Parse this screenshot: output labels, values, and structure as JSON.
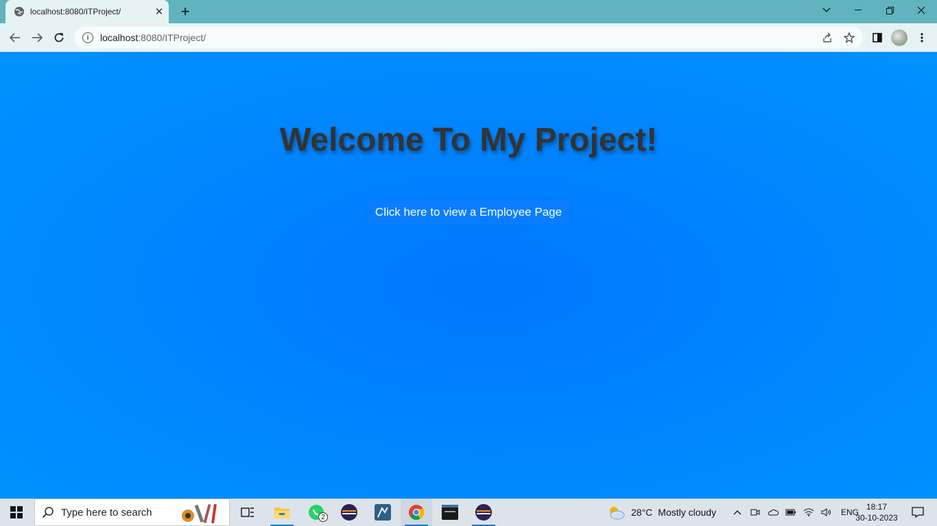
{
  "browser": {
    "tab_title": "localhost:8080/ITProject/",
    "tab_close": "✕",
    "new_tab": "+",
    "url_host": "localhost",
    "url_rest": ":8080/ITProject/",
    "icons": [
      "globe-icon",
      "back-icon",
      "forward-icon",
      "reload-icon",
      "share-icon",
      "star-icon",
      "side-panel-icon",
      "profile-avatar",
      "menu-icon"
    ]
  },
  "page": {
    "heading": "Welcome To My Project!",
    "button_label": "Click here to view a Employee Page",
    "background_color": "#0a84ff",
    "heading_color": "#333333"
  },
  "taskbar": {
    "search_placeholder": "Type here to search",
    "whatsapp_badge": "2",
    "weather_temp": "28°C",
    "weather_text": "Mostly cloudy",
    "language": "ENG",
    "time": "18:17",
    "date": "30-10-2023"
  }
}
